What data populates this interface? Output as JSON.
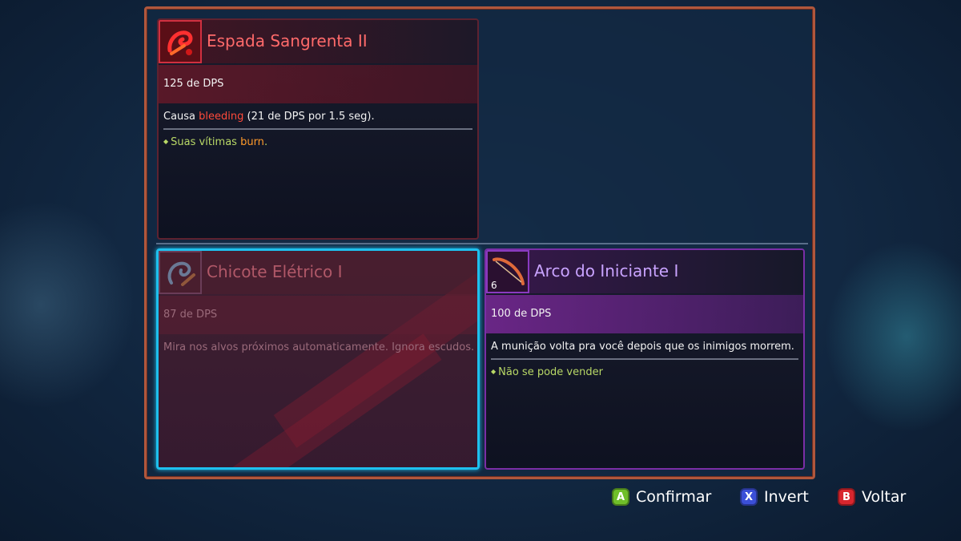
{
  "colors": {
    "frame_border": "#b0573c",
    "red_title": "#ff6a6a",
    "purple_title": "#c9a3ff",
    "bleeding": "#ff4a3a",
    "burn": "#ff9a2a",
    "bullet_green": "#b8d866",
    "selection_cyan": "#1ec0ee"
  },
  "current_item": {
    "name": "Espada Sangrenta II",
    "icon": "blood-sword-icon",
    "dps": "125 de DPS",
    "desc_prefix": "Causa ",
    "desc_effect": "bleeding",
    "desc_suffix": " (21 de DPS por 1.5 seg).",
    "bullet_prefix": "Suas vítimas ",
    "bullet_effect": "burn",
    "bullet_suffix": "."
  },
  "option_a": {
    "name": "Chicote Elétrico I",
    "icon": "electric-whip-icon",
    "dps": "87 de DPS",
    "desc": "Mira nos alvos próximos automaticamente. Ignora escudos."
  },
  "option_b": {
    "name": "Arco do Iniciante I",
    "icon": "beginner-bow-icon",
    "quantity": "6",
    "dps": "100 de DPS",
    "desc": "A munição volta pra você depois que os inimigos morrem.",
    "bullet": "Não se pode vender"
  },
  "buttons": {
    "confirm": {
      "key": "A",
      "label": "Confirmar",
      "color": "#6fbf2a"
    },
    "invert": {
      "key": "X",
      "label": "Invert",
      "color": "#3b4fd8"
    },
    "back": {
      "key": "B",
      "label": "Voltar",
      "color": "#d8262e"
    }
  }
}
